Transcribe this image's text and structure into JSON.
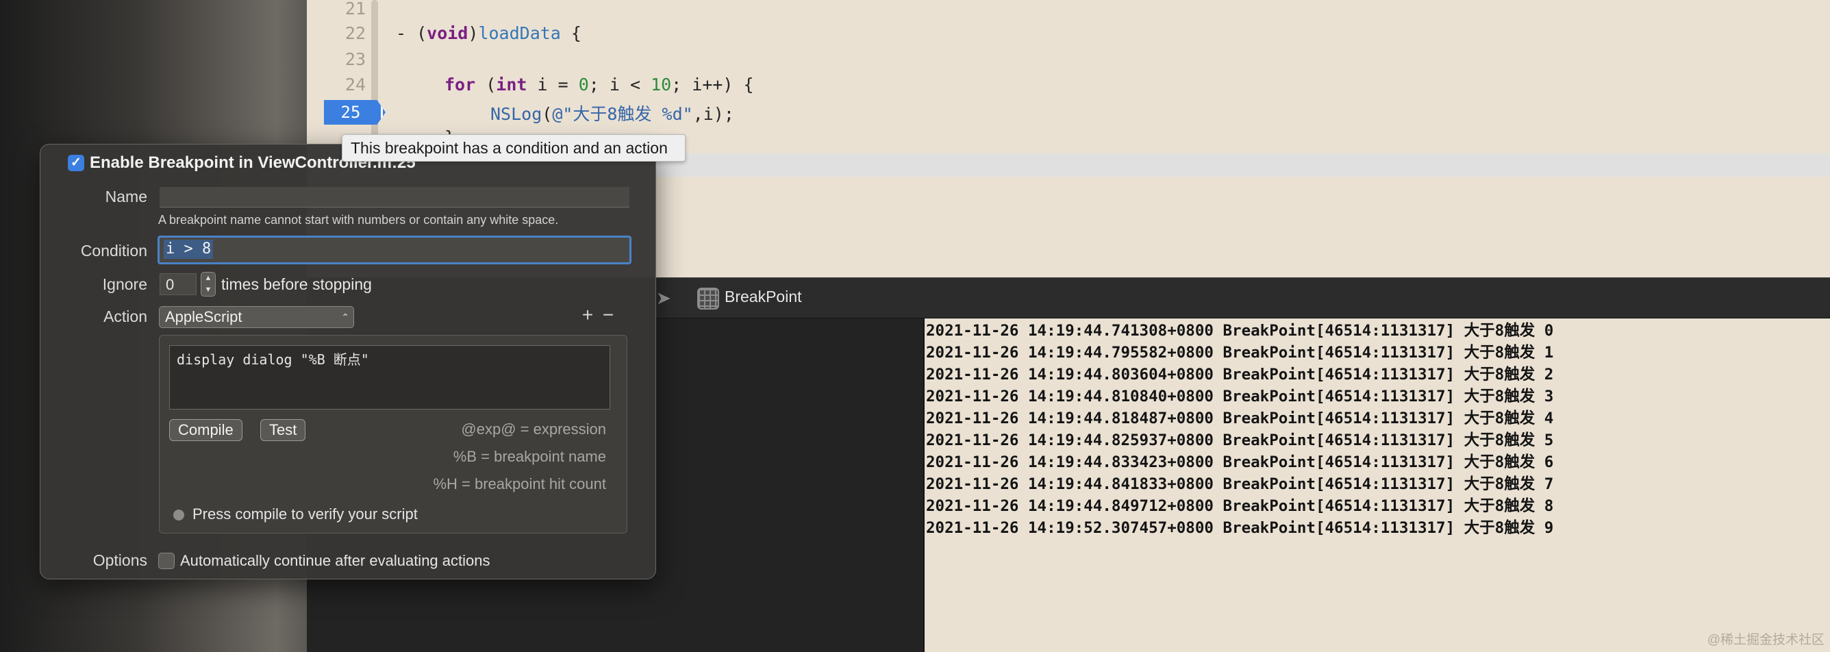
{
  "editor": {
    "line_numbers": [
      "21",
      "22",
      "23",
      "24",
      "25"
    ],
    "code": {
      "l22_prefix": "- (",
      "l22_type": "void",
      "l22_paren": ")",
      "l22_method": "loadData",
      "l22_brace": " {",
      "l24_for": "for",
      "l24_open": " (",
      "l24_int": "int",
      "l24_mid": " i = ",
      "l24_zero": "0",
      "l24_mid2": "; i < ",
      "l24_ten": "10",
      "l24_end": "; i++) {",
      "l25_fn": "NSLog",
      "l25_open": "(",
      "l25_str": "@\"大于8触发 %d\"",
      "l25_end": ",i);",
      "l26_brace": "}"
    },
    "breakpoint_line": "25",
    "breakpoint_color": "#3b7fe0"
  },
  "tooltip": {
    "text": "This breakpoint has a condition and an action"
  },
  "popover": {
    "title": "Enable Breakpoint in ViewController.m:25",
    "enabled": true,
    "name_label": "Name",
    "name_value": "",
    "name_hint": "A breakpoint name cannot start with numbers or contain any white space.",
    "condition_label": "Condition",
    "condition_value": "i > 8",
    "ignore_label": "Ignore",
    "ignore_value": "0",
    "ignore_suffix": "times before stopping",
    "action_label": "Action",
    "action_value": "AppleScript",
    "script": "display dialog \"%B 断点\"",
    "compile_button": "Compile",
    "test_button": "Test",
    "legend_exp": "@exp@ = expression",
    "legend_name": "%B = breakpoint name",
    "legend_hits": "%H = breakpoint hit count",
    "status_text": "Press compile to verify your script",
    "options_label": "Options",
    "options_text": "Automatically continue after evaluating actions"
  },
  "debug_bar": {
    "app_name": "BreakPoint"
  },
  "console": {
    "lines": [
      "2021-11-26 14:19:44.741308+0800 BreakPoint[46514:1131317] 大于8触发 0",
      "2021-11-26 14:19:44.795582+0800 BreakPoint[46514:1131317] 大于8触发 1",
      "2021-11-26 14:19:44.803604+0800 BreakPoint[46514:1131317] 大于8触发 2",
      "2021-11-26 14:19:44.810840+0800 BreakPoint[46514:1131317] 大于8触发 3",
      "2021-11-26 14:19:44.818487+0800 BreakPoint[46514:1131317] 大于8触发 4",
      "2021-11-26 14:19:44.825937+0800 BreakPoint[46514:1131317] 大于8触发 5",
      "2021-11-26 14:19:44.833423+0800 BreakPoint[46514:1131317] 大于8触发 6",
      "2021-11-26 14:19:44.841833+0800 BreakPoint[46514:1131317] 大于8触发 7",
      "2021-11-26 14:19:44.849712+0800 BreakPoint[46514:1131317] 大于8触发 8",
      "2021-11-26 14:19:52.307457+0800 BreakPoint[46514:1131317] 大于8触发 9"
    ]
  },
  "watermark": "@稀土掘金技术社区"
}
